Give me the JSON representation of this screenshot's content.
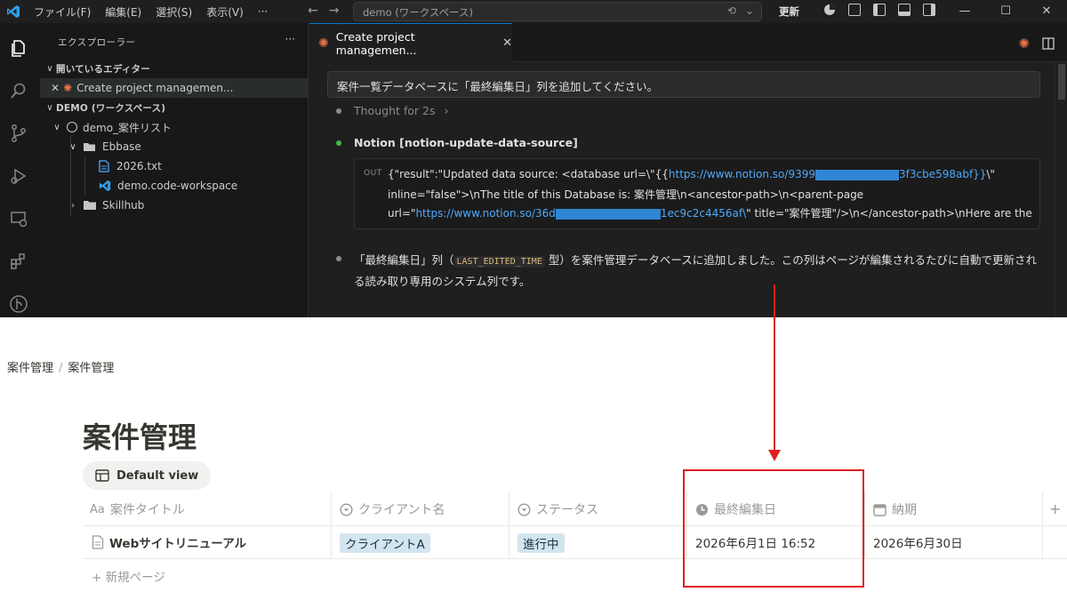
{
  "vscode": {
    "menu": [
      "ファイル(F)",
      "編集(E)",
      "選択(S)",
      "表示(V)",
      "···"
    ],
    "search": "demo (ワークスペース)",
    "update_label": "更新",
    "window_controls": [
      "—",
      "☐",
      "✕"
    ],
    "sidebar": {
      "title": "エクスプローラー",
      "more": "···",
      "open_editors_label": "開いているエディター",
      "open_editor_file": "Create project managemen...",
      "workspace_label": "DEMO (ワークスペース)",
      "tree": {
        "root": "demo_案件リスト",
        "folder_ebbase": "Ebbase",
        "file_txt": "2026.txt",
        "file_ws": "demo.code-workspace",
        "folder_skillhub": "Skillhub"
      }
    },
    "tab": {
      "label": "Create project managemen...",
      "close": "✕"
    },
    "chat": {
      "prompt": "案件一覧データベースに「最終編集日」列を追加してください。",
      "thought": "Thought for 2s",
      "thought_chevron": "›",
      "tool_title": "Notion [notion-update-data-source]",
      "out_label": "OUT",
      "out_line1_a": "{\"result\":\"Updated data source: <database url=\\\"{{",
      "out_line1_link_a": "https://www.notion.so/9399",
      "out_line1_link_b": "3f3cbe598abf}}",
      "out_line1_b": "\\\"",
      "out_line2": "inline=\"false\">\\nThe title of this Database is: 案件管理\\n<ancestor-path>\\n<parent-page",
      "out_line3_a": "url=\"",
      "out_line3_link_a": "https://www.notion.so/36d",
      "out_line3_link_b": "1ec9c2c4456af\\",
      "out_line3_b": "\" title=\"案件管理\"/>\\n</ancestor-path>\\nHere are the",
      "answer_pre": "「最終編集日」列（",
      "answer_code": "LAST_EDITED_TIME",
      "answer_post": " 型）を案件管理データベースに追加しました。この列はページが編集されるたびに自動で更新される読み取り専用のシステム列です。"
    }
  },
  "notion": {
    "breadcrumb": [
      "案件管理",
      "案件管理"
    ],
    "breadcrumb_sep": "/",
    "title": "案件管理",
    "view_label": "Default view",
    "columns": [
      {
        "icon": "Aa",
        "label": "案件タイトル"
      },
      {
        "icon": "select-icon",
        "label": "クライアント名"
      },
      {
        "icon": "status-icon",
        "label": "ステータス"
      },
      {
        "icon": "clock-icon",
        "label": "最終編集日"
      },
      {
        "icon": "calendar-icon",
        "label": "納期"
      }
    ],
    "add_column": "+",
    "row": {
      "title": "Webサイトリニューアル",
      "client": "クライアントA",
      "status": "進行中",
      "last_edited": "2026年6月1日 16:52",
      "due": "2026年6月30日"
    },
    "new_page": "+  新規ページ"
  },
  "colors": {
    "accent_blue": "#0078d4",
    "annotation_red": "#e02020",
    "tag_bg": "#d3e5ef"
  }
}
